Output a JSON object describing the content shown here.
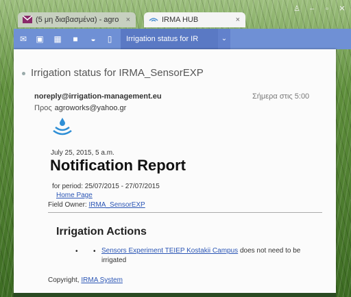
{
  "browser": {
    "tabs": [
      {
        "label": "(5 μη διαβασμένα) - agro",
        "icon": "mail-icon"
      },
      {
        "label": "IRMA HUB",
        "icon": "irma-icon"
      }
    ],
    "window_controls": [
      "minimize-icon",
      "restore-icon",
      "close-icon"
    ]
  },
  "toolbar": {
    "buttons": [
      "mail-icon",
      "contacts-icon",
      "calendar-icon",
      "notes-icon",
      "circle-icon",
      "phone-icon"
    ],
    "active_tab_label": "Irrigation status for IR",
    "dropdown_glyph": "⌄"
  },
  "message": {
    "subject": "Irrigation status for IRMA_SensorEXP",
    "from": "noreply@irrigation-management.eu",
    "received": "Σήμερα στις 5:00",
    "to_label": "Προς",
    "to_value": "agroworks@yahoo.gr"
  },
  "report": {
    "logo_icon": "water-drop-icon",
    "date": "July 25, 2015, 5 a.m.",
    "title": "Notification Report",
    "period": "for period: 25/07/2015 - 27/07/2015",
    "home_link": "Home Page",
    "field_owner_label": "Field Owner:",
    "field_owner_link": "IRMA_SensorEXP",
    "actions_heading": "Irrigation Actions",
    "action_link": "Sensors Experiment TEIEP Kostakii Campus",
    "action_text": " does not need to be irrigated",
    "copyright_label": "Copyright,",
    "copyright_link": "IRMA System"
  },
  "colors": {
    "accent": "#6f90d5",
    "link": "#2a55b5"
  }
}
